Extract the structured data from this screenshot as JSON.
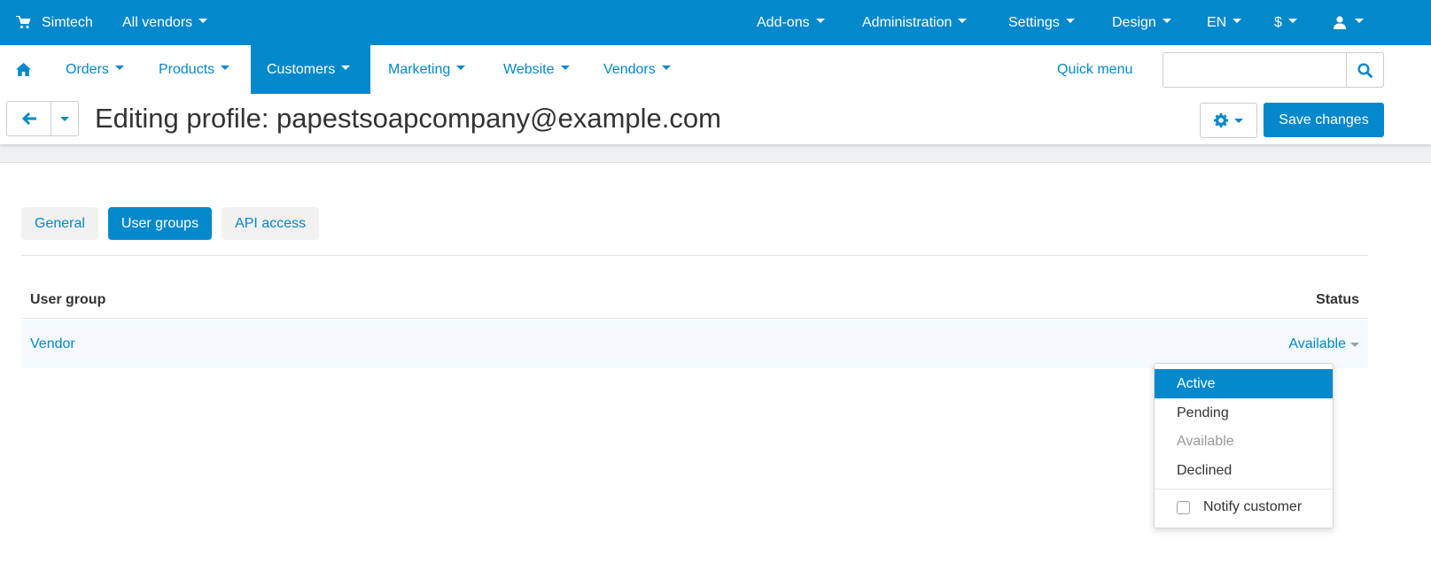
{
  "topbar": {
    "brand": "Simtech",
    "vendor_selector": "All vendors",
    "menus": [
      "Add-ons",
      "Administration",
      "Settings",
      "Design",
      "EN",
      "$"
    ],
    "icons": {
      "cart": "shopping-cart-icon",
      "user": "user-icon"
    }
  },
  "nav": {
    "home_icon": "home-icon",
    "items": [
      "Orders",
      "Products",
      "Customers",
      "Marketing",
      "Website",
      "Vendors"
    ],
    "active_item": "Customers",
    "quick_menu": "Quick menu",
    "search_placeholder": ""
  },
  "titlebar": {
    "title": "Editing profile: papestsoapcompany@example.com",
    "save_label": "Save changes"
  },
  "tabs": {
    "items": [
      "General",
      "User groups",
      "API access"
    ],
    "active": "User groups"
  },
  "table": {
    "headers": {
      "group": "User group",
      "status": "Status"
    },
    "rows": [
      {
        "group": "Vendor",
        "status": "Available"
      }
    ]
  },
  "status_dropdown": {
    "options": [
      "Active",
      "Pending",
      "Available",
      "Declined"
    ],
    "highlighted": "Active",
    "disabled": "Available",
    "notify_label": "Notify customer",
    "notify_checked": false
  },
  "colors": {
    "accent": "#0388cc",
    "strip": "#eef0f2",
    "row_highlight": "#f4fafd"
  }
}
